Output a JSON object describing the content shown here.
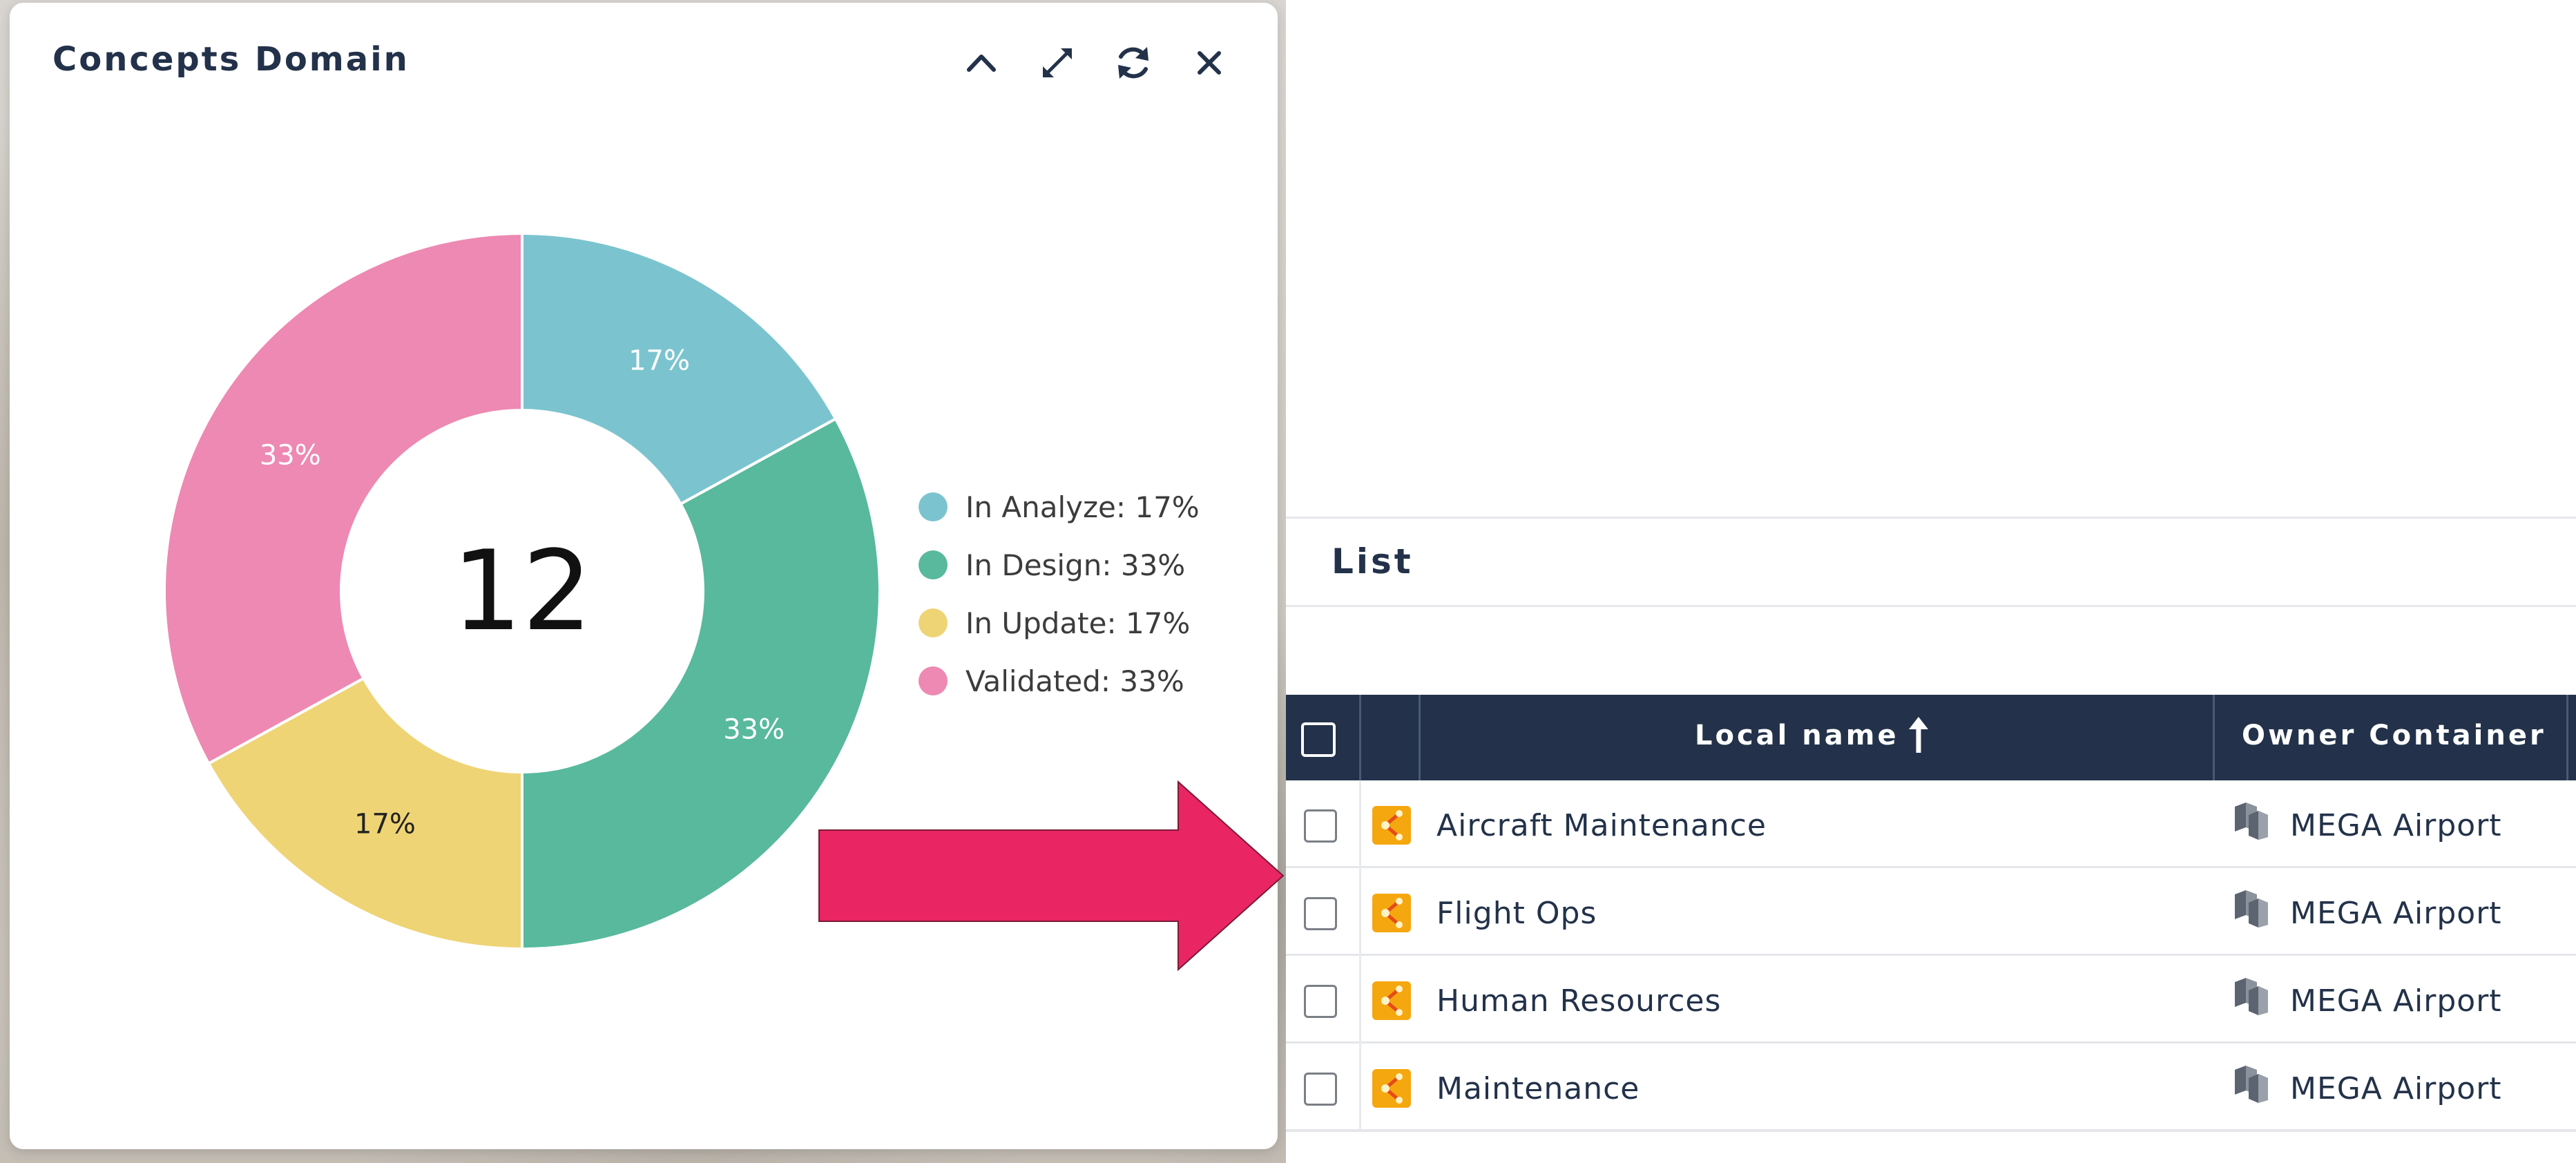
{
  "widget": {
    "title": "Concepts Domain",
    "tools": [
      {
        "name": "collapse",
        "icon": "chevron-up-icon"
      },
      {
        "name": "expand",
        "icon": "expand-arrows-icon"
      },
      {
        "name": "refresh",
        "icon": "refresh-icon"
      },
      {
        "name": "close",
        "icon": "close-icon"
      }
    ]
  },
  "chart_data": {
    "type": "pie",
    "variant": "donut",
    "center_label": "12",
    "categories": [
      "In Analyze",
      "In Design",
      "In Update",
      "Validated"
    ],
    "values": [
      17,
      33,
      17,
      33
    ],
    "slice_labels": [
      "17%",
      "33%",
      "17%",
      "33%"
    ],
    "legend": [
      "In Analyze: 17%",
      "In Design: 33%",
      "In Update: 17%",
      "Validated: 33%"
    ],
    "colors": [
      "#7bc4cf",
      "#58b99d",
      "#efd476",
      "#ed89b2"
    ],
    "label_colors": [
      "#ffffff",
      "#ffffff",
      "#222222",
      "#ffffff"
    ],
    "legend_position": "right"
  },
  "arrow": {
    "color": "#e92563",
    "direction": "right"
  },
  "list": {
    "title": "List",
    "columns": [
      {
        "label": "Local name",
        "sorted": "ascending"
      },
      {
        "label": "Owner Container"
      }
    ],
    "rows": [
      {
        "name": "Aircraft Maintenance",
        "owner": "MEGA Airport"
      },
      {
        "name": "Flight Ops",
        "owner": "MEGA Airport"
      },
      {
        "name": "Human Resources",
        "owner": "MEGA Airport"
      },
      {
        "name": "Maintenance",
        "owner": "MEGA Airport"
      }
    ],
    "row_icon": "domain-icon",
    "owner_icon": "library-icon",
    "header_color": "#23324a"
  }
}
